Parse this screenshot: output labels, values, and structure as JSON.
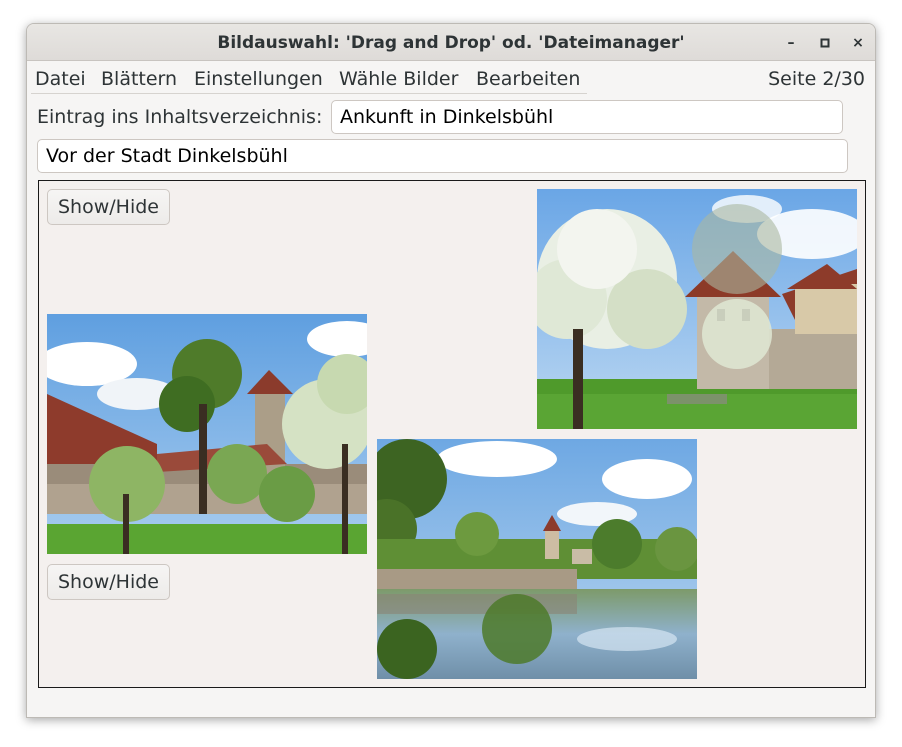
{
  "window": {
    "title": "Bildauswahl: 'Drag and Drop' od. 'Dateimanager'",
    "controls": {
      "minimize": "–",
      "maximize": "▫",
      "close": "×"
    }
  },
  "menu": {
    "items": [
      {
        "label": "Datei"
      },
      {
        "label": "Blättern"
      },
      {
        "label": "Einstellungen"
      },
      {
        "label": "Wähle Bilder"
      },
      {
        "label": "Bearbeiten"
      }
    ],
    "page_indicator": "Seite 2/30"
  },
  "toc": {
    "label": "Eintrag ins Inhaltsverzeichnis:",
    "value": "Ankunft in Dinkelsbühl"
  },
  "caption": {
    "value": "Vor der Stadt Dinkelsbühl"
  },
  "canvas": {
    "show_hide_1": "Show/Hide",
    "show_hide_2": "Show/Hide"
  },
  "colors": {
    "sky": "#7fb2e5",
    "grass": "#4e9a2a",
    "roof": "#8f3a2c",
    "wall": "#a89d8c",
    "water": "#6c8fa0"
  }
}
